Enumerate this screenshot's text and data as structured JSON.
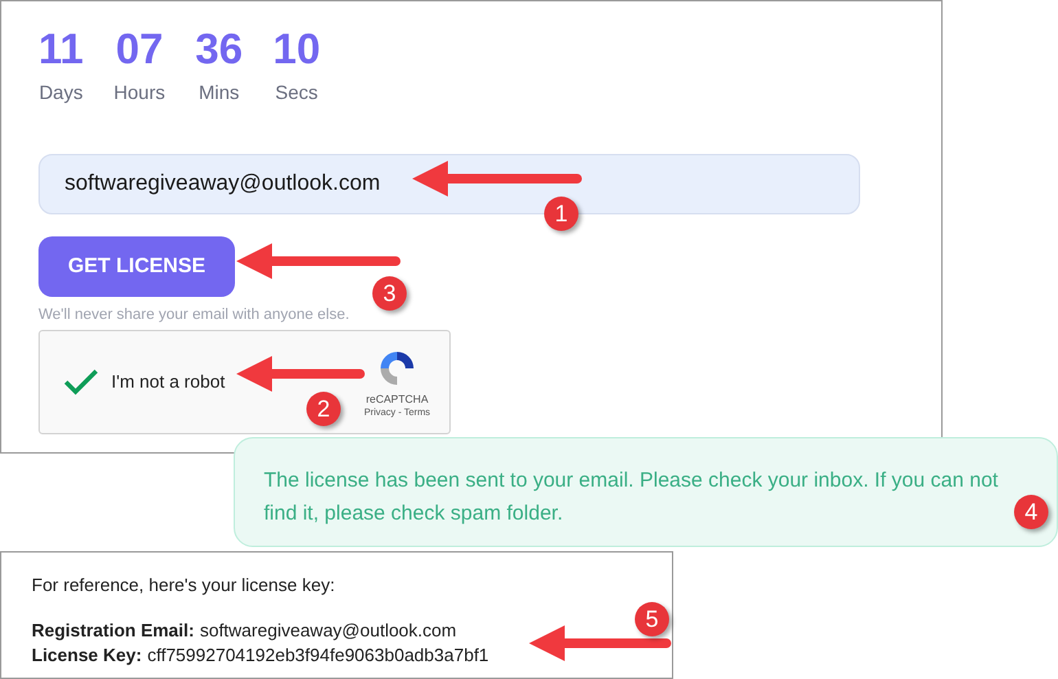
{
  "countdown": [
    {
      "value": "11",
      "unit": "Days"
    },
    {
      "value": "07",
      "unit": "Hours"
    },
    {
      "value": "36",
      "unit": "Mins"
    },
    {
      "value": "10",
      "unit": "Secs"
    }
  ],
  "email_field": {
    "value": "softwaregiveaway@outlook.com"
  },
  "get_license_button": {
    "label": "GET LICENSE"
  },
  "privacy_note": "We'll never share your email with anyone else.",
  "recaptcha": {
    "checked": true,
    "label": "I'm not a robot",
    "brand": "reCAPTCHA",
    "links": "Privacy - Terms"
  },
  "alert": {
    "message": "The license has been sent to your email. Please check your inbox. If you can not find it, please check spam folder."
  },
  "reference": {
    "intro": "For reference, here's your license key:",
    "fields": [
      {
        "label": "Registration Email:",
        "value": "softwaregiveaway@outlook.com"
      },
      {
        "label": "License Key:",
        "value": "cff75992704192eb3f94fe9063b0adb3a7bf1"
      }
    ]
  },
  "annotations": [
    {
      "number": "1"
    },
    {
      "number": "2"
    },
    {
      "number": "3"
    },
    {
      "number": "4"
    },
    {
      "number": "5"
    }
  ]
}
